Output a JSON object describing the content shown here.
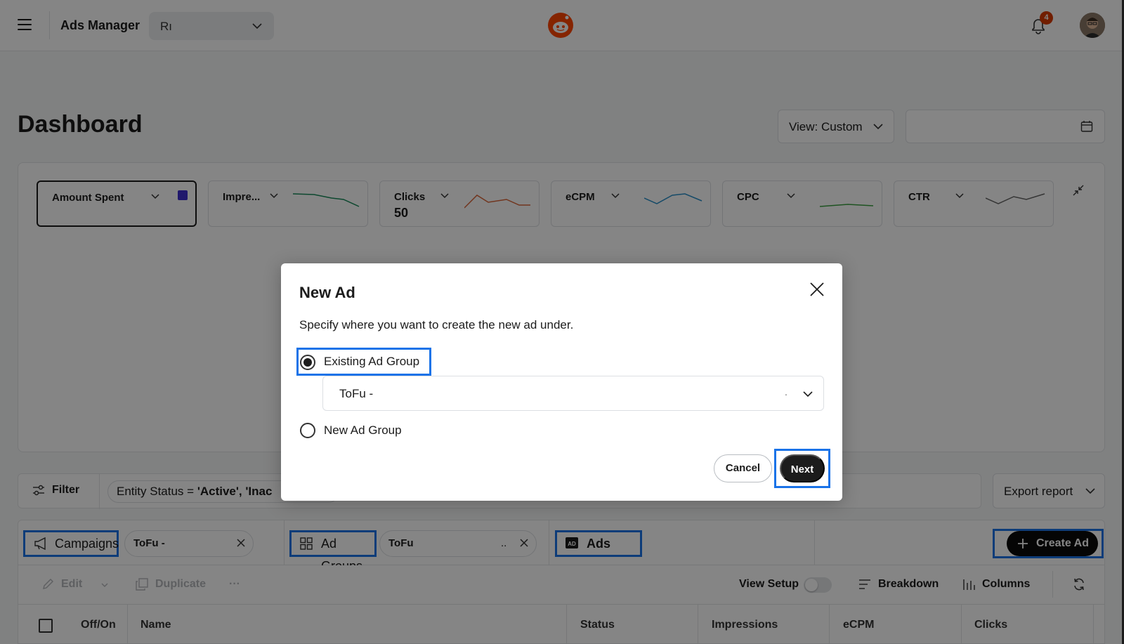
{
  "header": {
    "app_title": "Ads Manager",
    "account_value": "Rı",
    "notification_count": "4",
    "icons": [
      "hamburger-icon",
      "reddit-logo",
      "bell-icon",
      "avatar"
    ]
  },
  "dashboard": {
    "title": "Dashboard",
    "view_label": "View: Custom"
  },
  "metrics": [
    {
      "label": "Amount Spent",
      "value": ""
    },
    {
      "label": "Impre...",
      "value": ""
    },
    {
      "label": "Clicks",
      "value": "50"
    },
    {
      "label": "eCPM",
      "value": ""
    },
    {
      "label": "CPC",
      "value": ""
    },
    {
      "label": "CTR",
      "value": ""
    }
  ],
  "filters": {
    "filter_label": "Filter",
    "status_prefix": "Entity Status = ",
    "status_value": "'Active', 'Inac",
    "export_label": "Export report"
  },
  "tabs": {
    "campaigns": "Campaigns",
    "campaign_chip": "ToFu -",
    "ad_groups": "Ad Groups",
    "ad_group_chip": "ToFu",
    "ad_group_chip_tail": "..",
    "ads": "Ads",
    "create_ad": "Create Ad"
  },
  "toolbar": {
    "edit": "Edit",
    "duplicate": "Duplicate",
    "more": "···",
    "view_setup": "View Setup",
    "breakdown": "Breakdown",
    "columns": "Columns"
  },
  "table": {
    "columns": [
      "Off/On",
      "Name",
      "Status",
      "Impressions",
      "eCPM",
      "Clicks"
    ]
  },
  "modal": {
    "title": "New Ad",
    "description": "Specify where you want to create the new ad under.",
    "option_existing": "Existing Ad Group",
    "option_new": "New Ad Group",
    "selected_ad_group": "ToFu -",
    "selected_ad_group_tail": ".",
    "cancel": "Cancel",
    "next": "Next"
  },
  "colors": {
    "accent_blue": "#1a73e8",
    "brand_orange": "#ff4500",
    "swatch_purple": "#3e2fcf"
  }
}
